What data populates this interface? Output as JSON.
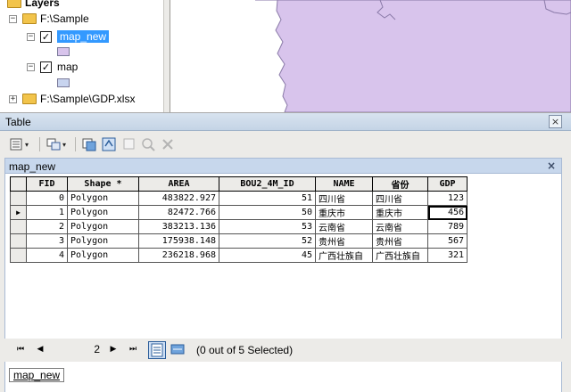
{
  "toc": {
    "root_label": "Layers",
    "items": [
      {
        "type": "folder",
        "label": "F:\\Sample",
        "expander": "−"
      },
      {
        "type": "layer",
        "label": "map_new",
        "checked": true,
        "expander": "−",
        "swatch_color": "#d8c4ec",
        "selected": true
      },
      {
        "type": "layer",
        "label": "map",
        "checked": true,
        "expander": "−",
        "swatch_color": "#c8d4ef"
      },
      {
        "type": "folder",
        "label": "F:\\Sample\\GDP.xlsx",
        "expander": "+"
      }
    ],
    "check_glyph": "✓"
  },
  "map": {
    "background": "#ffffff",
    "polygon_fill": "#d8c4ec",
    "polygon_stroke": "#8a7aa8"
  },
  "window": {
    "title": "Table",
    "close_glyph": "×"
  },
  "toolbar": {
    "icons": [
      "table-options-icon",
      "related-tables-icon",
      "select-by-attributes-icon",
      "switch-selection-icon",
      "clear-selection-icon",
      "zoom-to-selected-icon",
      "delete-selected-icon"
    ],
    "dropdown_glyph": "▾"
  },
  "tab": {
    "label": "map_new",
    "close_glyph": "×"
  },
  "table": {
    "columns": [
      "FID",
      "Shape *",
      "AREA",
      "BOU2_4M_ID",
      "NAME",
      "省份",
      "GDP"
    ],
    "rows": [
      {
        "indicator": "",
        "cells": [
          "0",
          "Polygon",
          "483822.927",
          "51",
          "四川省",
          "四川省",
          "123"
        ]
      },
      {
        "indicator": "▶",
        "cells": [
          "1",
          "Polygon",
          "82472.766",
          "50",
          "重庆市",
          "重庆市",
          "456"
        ]
      },
      {
        "indicator": "",
        "cells": [
          "2",
          "Polygon",
          "383213.136",
          "53",
          "云南省",
          "云南省",
          "789"
        ]
      },
      {
        "indicator": "",
        "cells": [
          "3",
          "Polygon",
          "175938.148",
          "52",
          "贵州省",
          "贵州省",
          "567"
        ]
      },
      {
        "indicator": "",
        "cells": [
          "4",
          "Polygon",
          "236218.968",
          "45",
          "广西壮族自",
          "广西壮族自",
          "321"
        ]
      }
    ]
  },
  "navigation": {
    "first_glyph": "⏮",
    "prev_glyph": "◀",
    "next_glyph": "▶",
    "last_glyph": "⏭",
    "current_record": "2",
    "selection_status": "(0 out of 5 Selected)"
  },
  "bottom_tab": {
    "label": "map_new"
  }
}
